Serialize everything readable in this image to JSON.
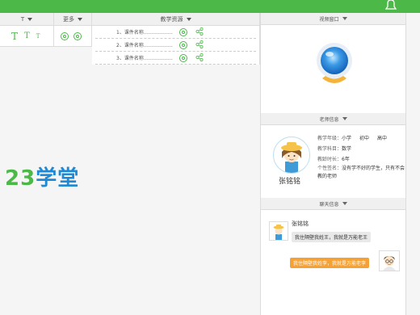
{
  "header": {
    "font_label": "T",
    "more_label": "更多",
    "resources_label": "教学资源",
    "font_sizes": [
      "T",
      "T",
      "T"
    ]
  },
  "resources": [
    {
      "label": "1、课件名称………………"
    },
    {
      "label": "2、课件名称………………"
    },
    {
      "label": "3、课件名称………………"
    }
  ],
  "logo": {
    "number": "23",
    "text": "学堂"
  },
  "video": {
    "title": "视频窗口"
  },
  "teacher": {
    "title": "老师信息",
    "name": "张铭铭",
    "grade_label": "教学年级：",
    "grades": [
      "小学",
      "初中",
      "高中"
    ],
    "subject_label": "教学科目：",
    "subject": "数学",
    "years_label": "教龄时长：",
    "years": "6年",
    "sign_label": "个性签名：",
    "sign": "没有学不好的学生，只有不会教的老师"
  },
  "chat": {
    "title": "聊天信息",
    "user": "张铭铭",
    "msg1": "我住隔壁我姓王，我就是万能老王",
    "msg2": "我住隔壁我姓李，我就是万能老李"
  },
  "colors": {
    "brand_green": "#4cb848",
    "logo_blue": "#1e8ad6",
    "bubble_orange": "#f6a133"
  }
}
